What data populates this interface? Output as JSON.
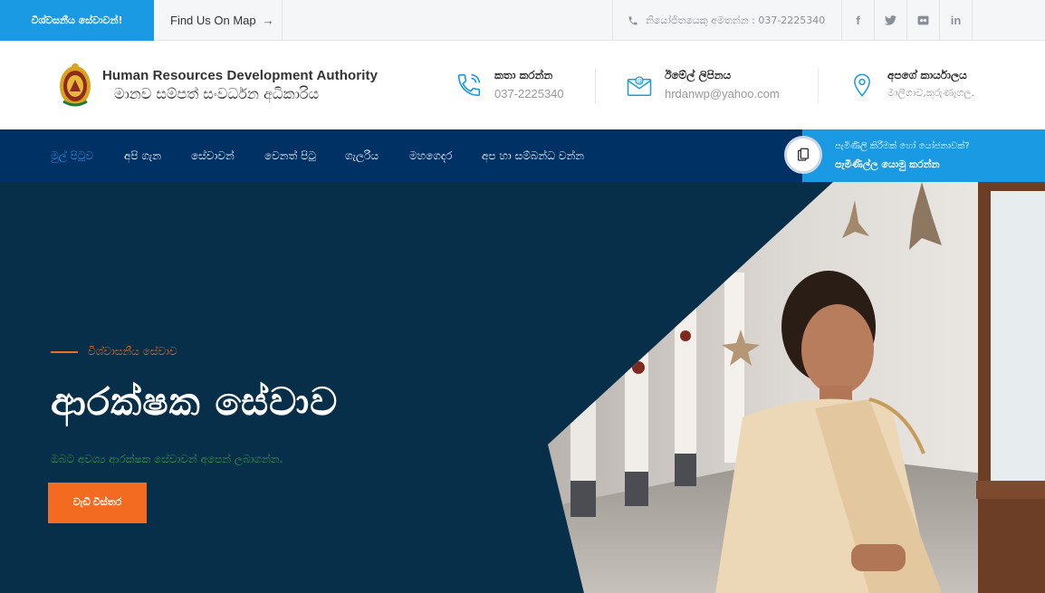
{
  "topbar": {
    "tag": "විශ්වසනීය සේවාවන්!",
    "map_link": "Find Us On Map",
    "phone_text": "නියෝජිතයෙකු අමතන්න : 037-2225340",
    "social": [
      "facebook-icon",
      "twitter-icon",
      "flickr-icon",
      "linkedin-icon"
    ]
  },
  "header": {
    "org_name_en": "Human Resources Development Authority",
    "org_name_si": "මානව සම්පත් සංවර්ධන අධිකාරිය",
    "contacts": [
      {
        "title": "කතා කරන්න",
        "value": "037-2225340",
        "icon": "phone-icon"
      },
      {
        "title": "ඊමේල් ලිපිනය",
        "value": "hrdanwp@yahoo.com",
        "icon": "email-icon"
      },
      {
        "title": "අපගේ කාර්යාලය",
        "value": "මාලිගාව,කුරුණෑගල.",
        "icon": "location-icon"
      }
    ]
  },
  "nav": {
    "items": [
      "මුල් පිටුව",
      "අපි ගැන",
      "සේවාවන්",
      "වෙනත් පිටු",
      "ගැලරිය",
      "මහගෙදර",
      "අප හා සම්බන්ධ වන්න"
    ],
    "active_index": 0,
    "cta_sub": "පැමිණිලි කිරීමක් හෝ යෝජනාවක්?",
    "cta_main": "පැමිණිල්ල යොමු කරන්න"
  },
  "hero": {
    "kicker": "විශ්වාසනීය සේවාව",
    "title": "ආරක්ෂක සේවාව",
    "subtitle": "ඔබට අවශ්‍ය ආරක්ෂක සේවාවන් අපෙන් ලබාගන්න.",
    "button": "වැඩි විස්තර"
  },
  "colors": {
    "brand_blue": "#1b9ae4",
    "navy": "#003165",
    "hero_bg": "#082f4a",
    "accent_orange": "#f26b21",
    "subtitle_green": "#2f9a46"
  }
}
